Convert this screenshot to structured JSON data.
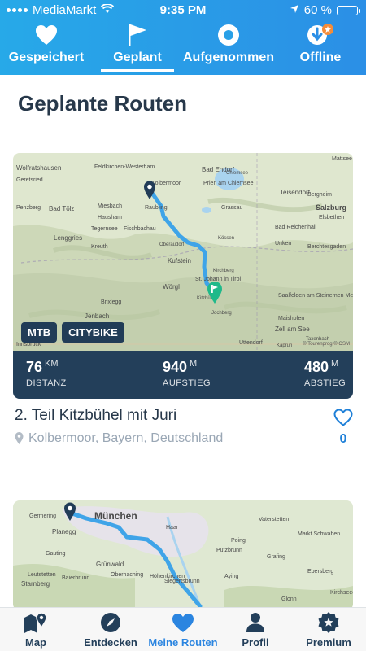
{
  "status": {
    "carrier": "MediaMarkt",
    "time": "9:35 PM",
    "battery": "60 %",
    "battery_level": 0.6
  },
  "tabs": [
    {
      "label": "Gespeichert",
      "icon": "heart-icon",
      "active": false
    },
    {
      "label": "Geplant",
      "icon": "flag-icon",
      "active": true
    },
    {
      "label": "Aufgenommen",
      "icon": "record-icon",
      "active": false
    },
    {
      "label": "Offline",
      "icon": "download-icon",
      "active": false
    }
  ],
  "page_title": "Geplante Routen",
  "routes": [
    {
      "tags": [
        "MTB",
        "CITYBIKE"
      ],
      "distance": {
        "value": "76",
        "unit": "KM",
        "label": "DISTANZ"
      },
      "ascent": {
        "value": "940",
        "unit": "M",
        "label": "AUFSTIEG"
      },
      "descent": {
        "value": "480",
        "unit": "M",
        "label": "ABSTIEG"
      },
      "name": "2. Teil Kitzbühel mit Juri",
      "location": "Kolbermoor, Bayern, Deutschland",
      "likes": "0",
      "map_labels": [
        "Mattsee",
        "Wolfratshausen",
        "Feldkirchen-Westerham",
        "Bad Endorf",
        "Chiemsee",
        "Geretsried",
        "Kolbermoor",
        "Prien am Chiemsee",
        "Teisendorf",
        "Bergheim",
        "Salzburg",
        "Penzberg",
        "Bad Tölz",
        "Miesbach",
        "Raubling",
        "Grassau",
        "Elsbethen",
        "Hausham",
        "Tegernsee",
        "Fischbachau",
        "Bad Reichenhall",
        "Lenggries",
        "Kreuth",
        "Oberaudorf",
        "Kössen",
        "Unken",
        "Berchtesgaden",
        "Kufstein",
        "Wörgl",
        "St. Johann in Tirol",
        "Kirchberg",
        "Saalfelden am Steinernen Meer",
        "Brixlegg",
        "Kitzbühel",
        "Jenbach",
        "Jochberg",
        "Maishofen",
        "Zell am See",
        "Uttendorf",
        "Innsbruck",
        "Taxenbach",
        "Kaprun"
      ],
      "map_attribution": "© Tourenprog © OSM"
    },
    {
      "map_labels": [
        "Germering",
        "München",
        "Planegg",
        "Gauting",
        "Grünwald",
        "Oberhaching",
        "Starnberg",
        "Haar",
        "Vaterstetten",
        "Poing",
        "Markt Schwaben",
        "Grafing",
        "Ebersberg",
        "Putzbrunn",
        "Siegertsbrunn",
        "Aying",
        "Kirchseeon",
        "Höhenkirchen",
        "Leutstetten",
        "Baierbrunn",
        "Glonn"
      ]
    }
  ],
  "bottom_nav": [
    {
      "label": "Map",
      "icon": "map-pin-icon",
      "active": false
    },
    {
      "label": "Entdecken",
      "icon": "compass-icon",
      "active": false
    },
    {
      "label": "Meine Routen",
      "icon": "heart-icon",
      "active": true
    },
    {
      "label": "Profil",
      "icon": "person-icon",
      "active": false
    },
    {
      "label": "Premium",
      "icon": "gear-badge-icon",
      "active": false
    }
  ]
}
